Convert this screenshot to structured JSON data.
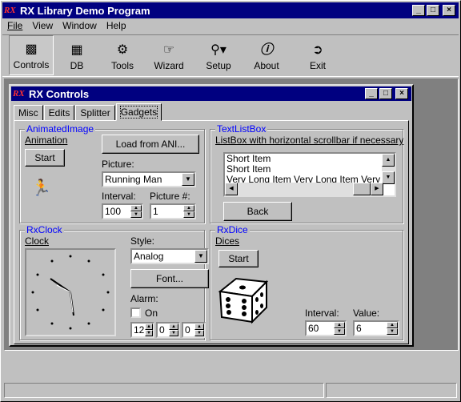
{
  "app": {
    "title": "RX Library Demo Program",
    "logo": "RX"
  },
  "menu": [
    "File",
    "View",
    "Window",
    "Help"
  ],
  "toolbar": [
    {
      "label": "Controls",
      "icon": "controls-icon"
    },
    {
      "label": "DB",
      "icon": "db-icon"
    },
    {
      "label": "Tools",
      "icon": "tools-icon"
    },
    {
      "label": "Wizard",
      "icon": "pointing-hand-icon"
    },
    {
      "label": "Setup",
      "icon": "key-icon"
    },
    {
      "label": "About",
      "icon": "info-icon"
    },
    {
      "label": "Exit",
      "icon": "exit-door-icon"
    }
  ],
  "child": {
    "title": "RX Controls",
    "tabs": [
      "Misc",
      "Edits",
      "Splitter",
      "Gadgets"
    ]
  },
  "animated": {
    "group": "AnimatedImage",
    "label": "Animation",
    "start": "Start",
    "load": "Load from ANI...",
    "picture_label": "Picture:",
    "picture_value": "Running Man",
    "interval_label": "Interval:",
    "interval_value": "100",
    "picnum_label": "Picture #:",
    "picnum_value": "1"
  },
  "textlist": {
    "group": "TextListBox",
    "label": "ListBox with horizontal scrollbar if necessary",
    "items": [
      "Short Item",
      "Short Item",
      "Very Long Item Very Long Item Very Long"
    ],
    "back": "Back"
  },
  "clock": {
    "group": "RxClock",
    "label": "Clock",
    "style_label": "Style:",
    "style_value": "Analog",
    "font": "Font...",
    "alarm_label": "Alarm:",
    "on_label": "On",
    "h": "12",
    "m": "0",
    "s": "0"
  },
  "dice": {
    "group": "RxDice",
    "label": "Dices",
    "start": "Start",
    "interval_label": "Interval:",
    "interval_value": "60",
    "value_label": "Value:",
    "value_value": "6"
  }
}
